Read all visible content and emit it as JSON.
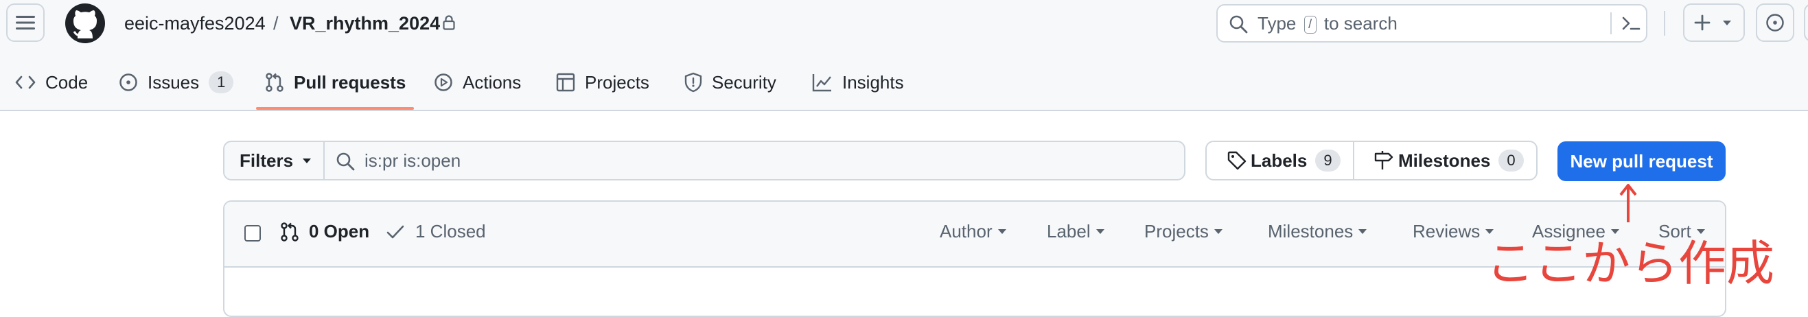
{
  "repo": {
    "owner": "eeic-mayfes2024",
    "separator": "/",
    "name": "VR_rhythm_2024"
  },
  "search": {
    "prefix": "Type",
    "key": "/",
    "suffix": "to search"
  },
  "tabs": [
    {
      "label": "Code",
      "icon": "code-icon"
    },
    {
      "label": "Issues",
      "icon": "issue-opened-icon",
      "count": "1"
    },
    {
      "label": "Pull requests",
      "icon": "git-pull-request-icon",
      "selected": true
    },
    {
      "label": "Actions",
      "icon": "play-icon"
    },
    {
      "label": "Projects",
      "icon": "table-icon"
    },
    {
      "label": "Security",
      "icon": "shield-icon"
    },
    {
      "label": "Insights",
      "icon": "graph-icon"
    }
  ],
  "toolbar": {
    "filters_label": "Filters",
    "query": "is:pr is:open",
    "labels_label": "Labels",
    "labels_count": "9",
    "milestones_label": "Milestones",
    "milestones_count": "0",
    "new_pr_label": "New pull request"
  },
  "list": {
    "open_label": "0 Open",
    "closed_label": "1 Closed",
    "filters": [
      "Author",
      "Label",
      "Projects",
      "Milestones",
      "Reviews",
      "Assignee",
      "Sort"
    ]
  },
  "annotation": {
    "text": "ここから作成",
    "color": "#e8453c"
  },
  "colors": {
    "accent_button": "#1f6feb",
    "tab_underline": "#fd8c73"
  }
}
